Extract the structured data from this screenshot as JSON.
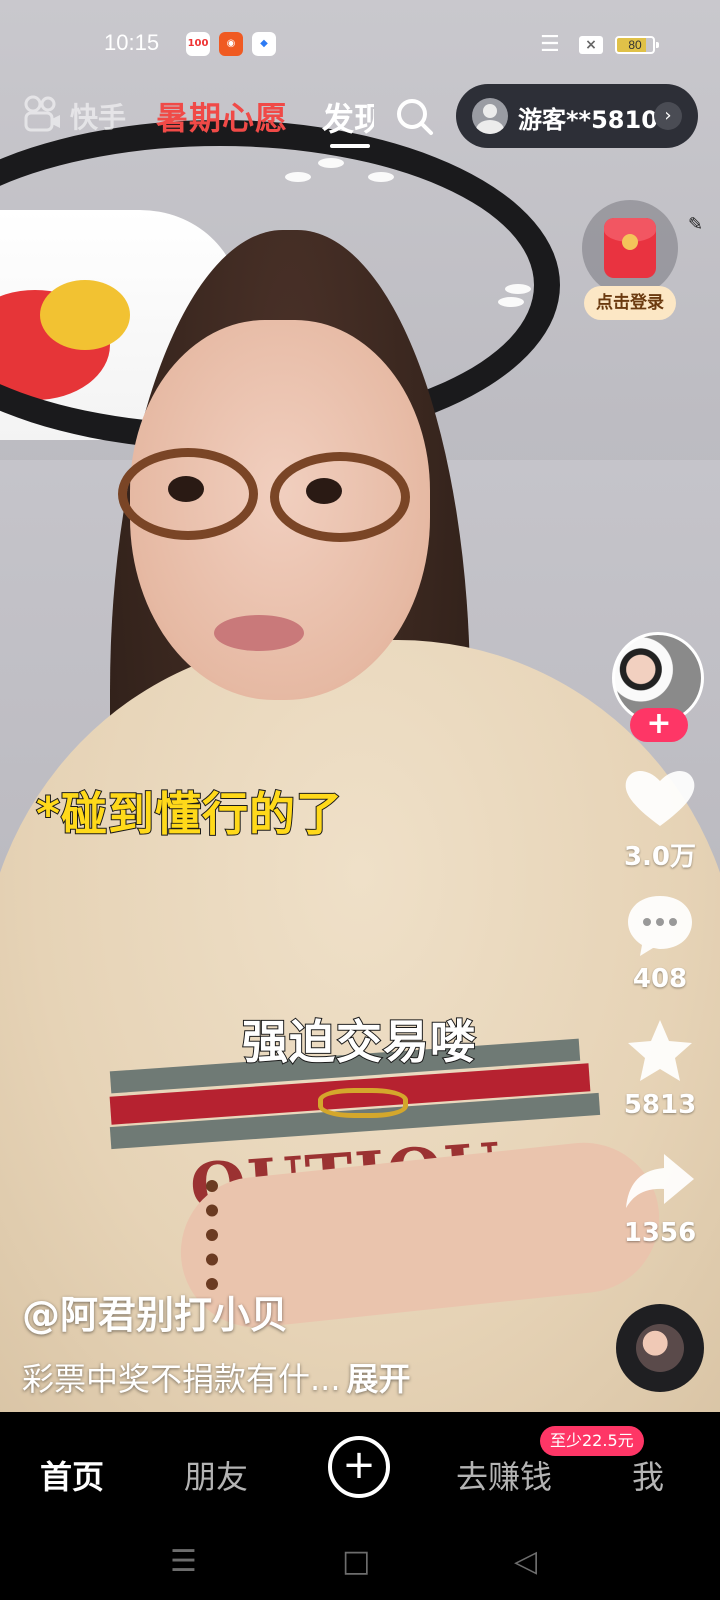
{
  "status_bar": {
    "time": "10:15",
    "app_icons": [
      "100-app-icon",
      "kuaishou-app-icon",
      "blue-app-icon"
    ],
    "battery": "80"
  },
  "top_nav": {
    "logo": "快手",
    "summer_tab": "暑期心愿",
    "discover_tab": "发现",
    "guest_name": "游客**5810"
  },
  "promo": {
    "login_badge": "点击登录"
  },
  "video": {
    "caption_top": "*碰到懂行的了",
    "caption_mid": "强迫交易喽",
    "shirt_print": "OUTIQU",
    "author": "@阿君别打小贝",
    "description": "彩票中奖不捐款有什...",
    "expand": "展开"
  },
  "actions": {
    "follow": "+",
    "likes": "3.0万",
    "comments": "408",
    "favorites": "5813",
    "shares": "1356"
  },
  "bottom_nav": {
    "home": "首页",
    "friends": "朋友",
    "create": "+",
    "earn": "去赚钱",
    "earn_badge": "至少22.5元",
    "me": "我"
  },
  "colors": {
    "accent_pink": "#fe3666",
    "summer_red": "#f04a47",
    "caption_yellow": "#ffd91a"
  }
}
